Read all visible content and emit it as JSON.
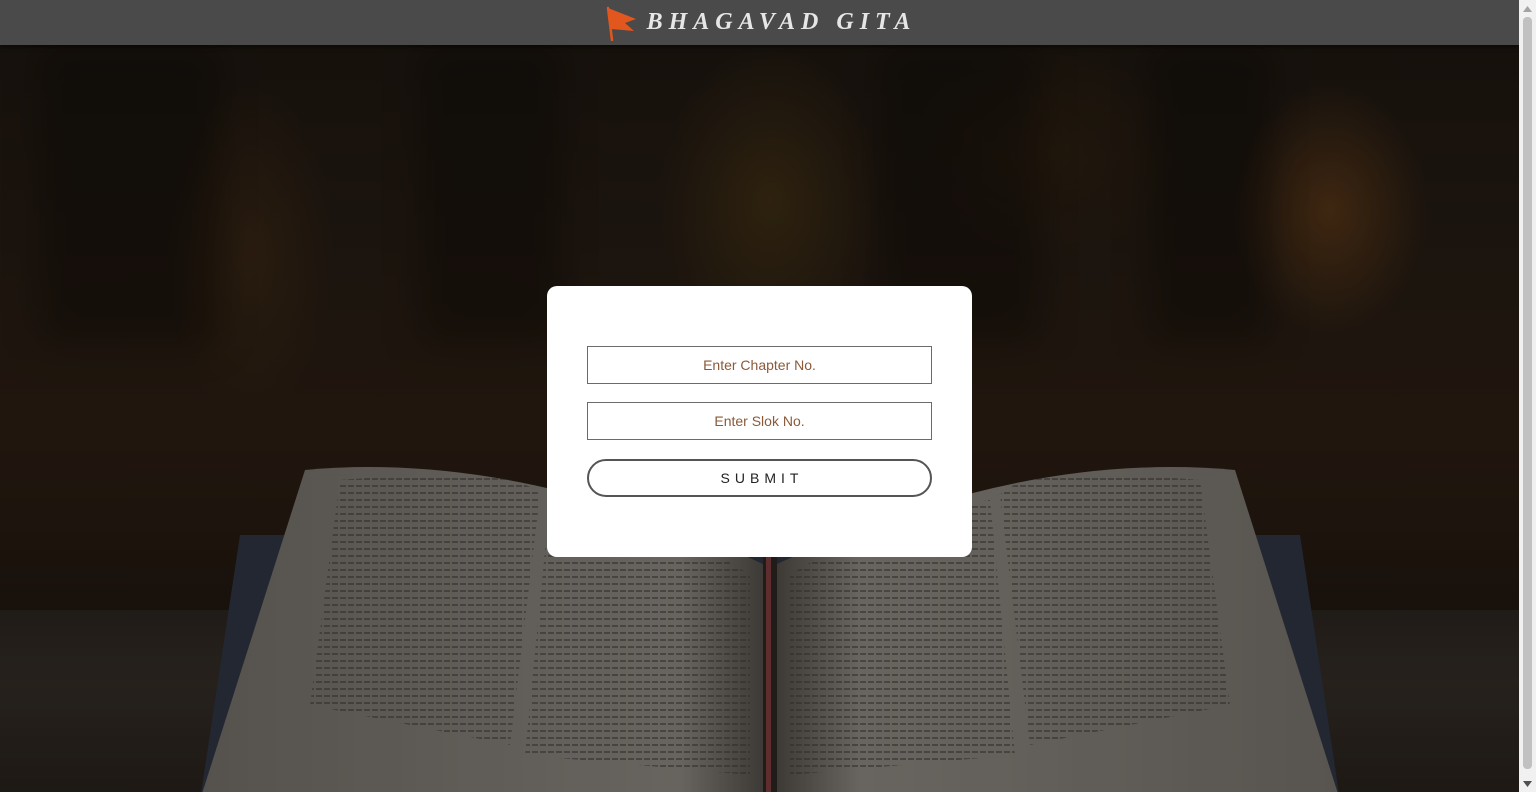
{
  "header": {
    "title": "BHAGAVAD GITA",
    "logo_icon": "saffron-flag-icon",
    "flag_color": "#e2571e"
  },
  "form": {
    "chapter_placeholder": "Enter Chapter No.",
    "chapter_value": "",
    "slok_placeholder": "Enter Slok No.",
    "slok_value": "",
    "submit_label": "SUBMIT"
  },
  "background": {
    "icon": "open-book-photo"
  },
  "colors": {
    "header_bg": "#4a4a4a",
    "card_bg": "#ffffff",
    "placeholder_text": "#8a5a3a"
  }
}
